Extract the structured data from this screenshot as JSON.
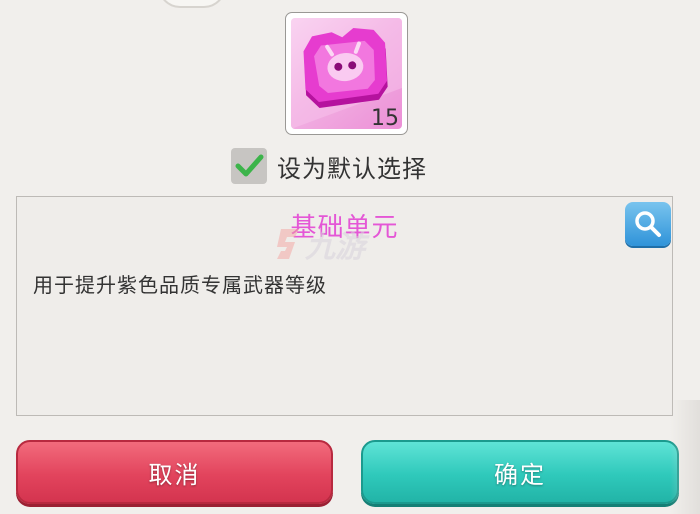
{
  "item": {
    "icon": "purple-token-icon",
    "quantity": "15"
  },
  "default_option": {
    "checked": true,
    "label": "设为默认选择"
  },
  "description": {
    "title": "基础单元",
    "text": "用于提升紫色品质专属武器等级",
    "zoom_icon": "magnifier-icon"
  },
  "watermark": {
    "text": "九游"
  },
  "buttons": {
    "cancel_label": "取消",
    "confirm_label": "确定"
  },
  "colors": {
    "title": "#e457d6",
    "cancel": "#e2445d",
    "confirm": "#2fc9bb",
    "checkmark": "#3cb44a"
  }
}
